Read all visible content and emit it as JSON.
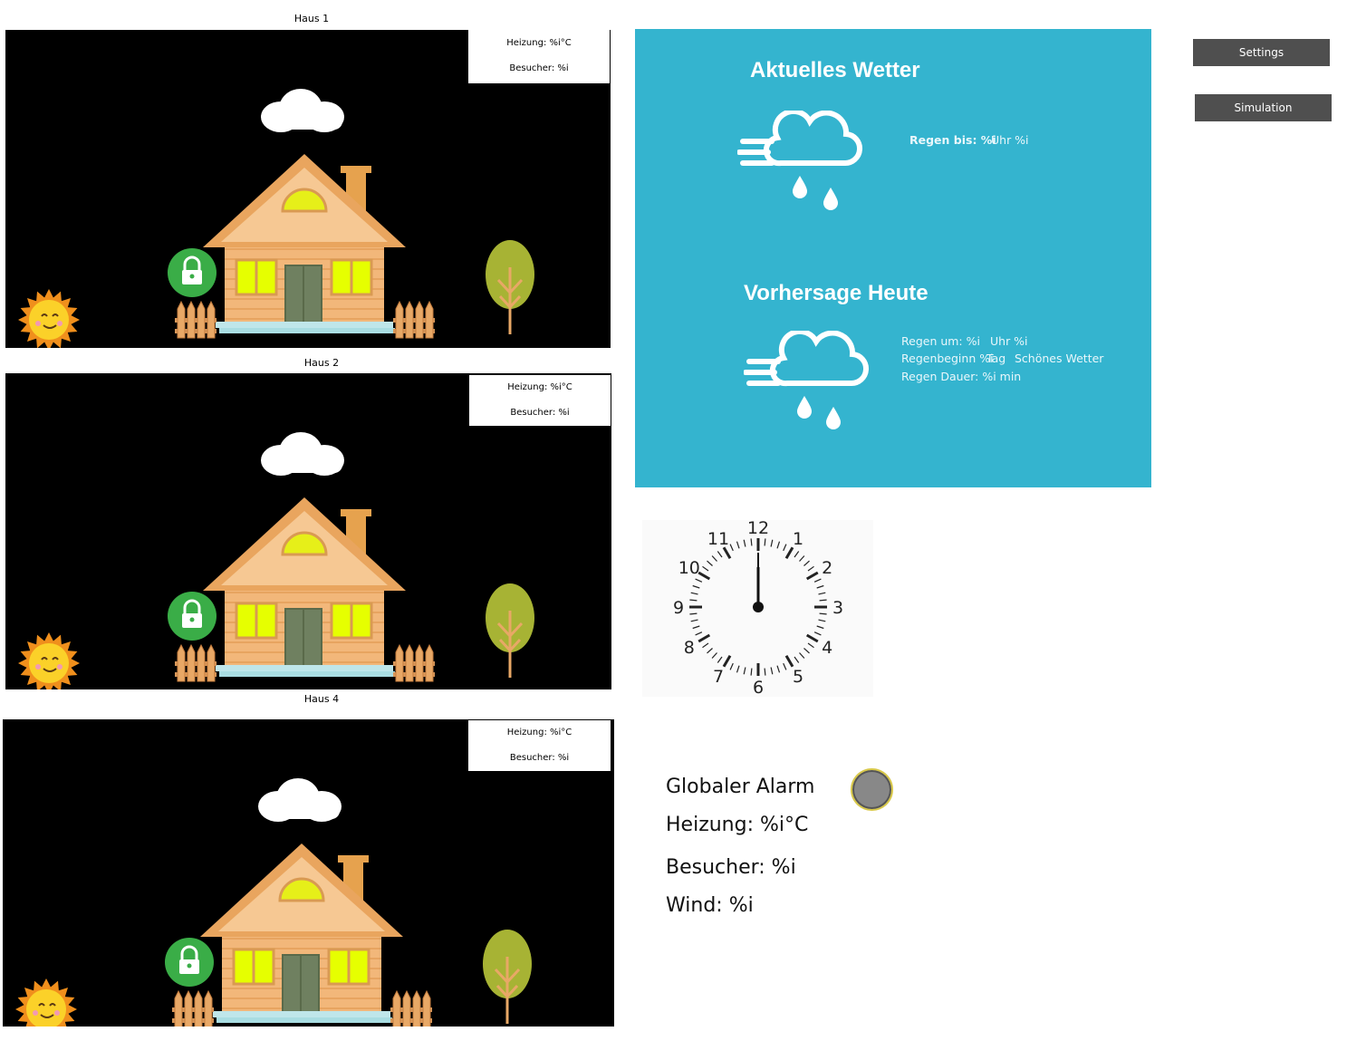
{
  "houses": [
    {
      "title": "Haus 1",
      "heizung": "Heizung: %i°C",
      "besucher": "Besucher: %i"
    },
    {
      "title": "Haus 2",
      "heizung": "Heizung: %i°C",
      "besucher": "Besucher: %i"
    },
    {
      "title": "Haus 4",
      "heizung": "Heizung: %i°C",
      "besucher": "Besucher: %i"
    }
  ],
  "weather": {
    "current_title": "Aktuelles Wetter",
    "current_line_a": "Regen bis: %i",
    "current_line_b": "Uhr %i",
    "forecast_title": "Vorhersage Heute",
    "forecast_line1_a": "Regen um: %i",
    "forecast_line1_b": "Uhr %i",
    "forecast_line2": "Regenbeginn %i",
    "forecast_line2_b": "Tag",
    "forecast_line2_c": "Schönes Wetter",
    "forecast_line3": "Regen Dauer: %i min",
    "background_color": "#34b4cf",
    "icon": "wind-cloud-rain-icon"
  },
  "buttons": {
    "settings": "Settings",
    "simulation": "Simulation"
  },
  "clock": {
    "numbers": [
      "12",
      "1",
      "2",
      "3",
      "4",
      "5",
      "6",
      "7",
      "8",
      "9",
      "10",
      "11"
    ],
    "time": "12:00"
  },
  "global": {
    "alarm_label": "Globaler Alarm",
    "heizung": "Heizung: %i°C",
    "besucher": "Besucher: %i",
    "wind": "Wind: %i"
  }
}
